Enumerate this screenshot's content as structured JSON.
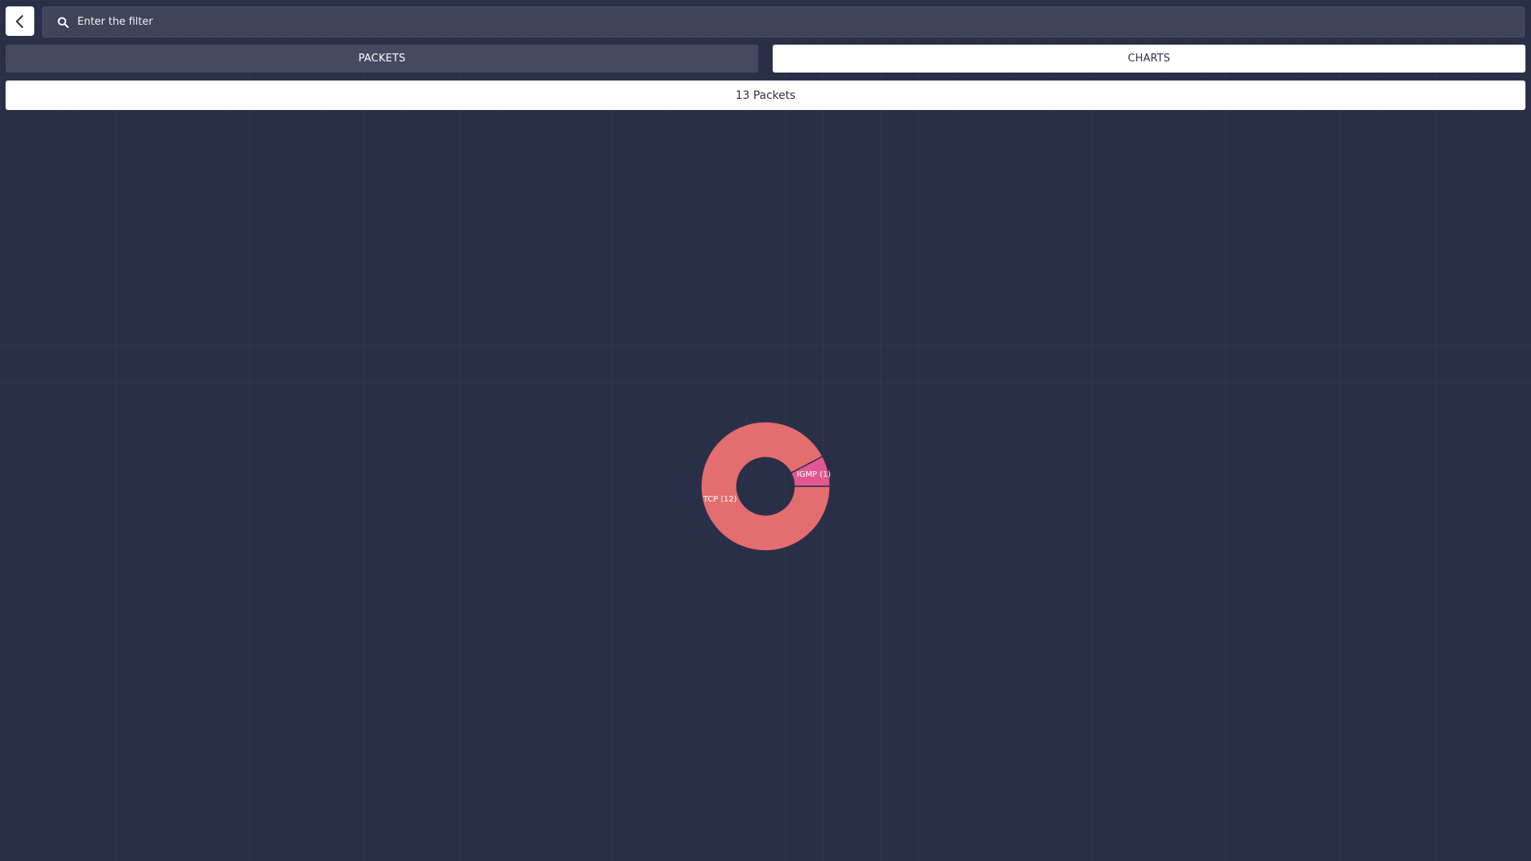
{
  "header": {
    "back_icon": "chevron-left-icon",
    "search_icon": "search-icon",
    "filter_placeholder": "Enter the filter",
    "filter_value": ""
  },
  "tabs": {
    "packets_label": "PACKETS",
    "charts_label": "CHARTS",
    "active": "charts"
  },
  "summary": {
    "count_text": "13 Packets"
  },
  "colors": {
    "background": "#2a2f48",
    "tcp": "#e36d6f",
    "igmp": "#e0588f"
  },
  "chart_data": {
    "type": "pie",
    "donut": true,
    "categories": [
      "TCP",
      "IGMP"
    ],
    "values": [
      12,
      1
    ],
    "labels": [
      "TCP (12)",
      "IGMP (1)"
    ],
    "colors": [
      "#e36d6f",
      "#e0588f"
    ]
  }
}
